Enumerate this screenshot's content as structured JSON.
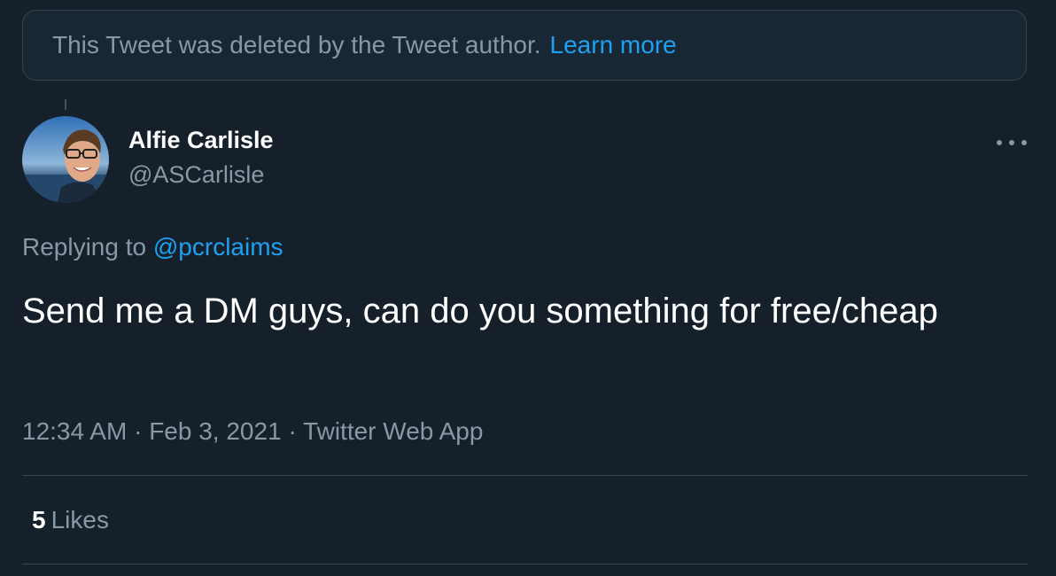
{
  "deleted_notice": {
    "text": "This Tweet was deleted by the Tweet author.",
    "learn_more": "Learn more"
  },
  "tweet": {
    "author_name": "Alfie Carlisle",
    "author_handle": "@ASCarlisle",
    "replying_label": "Replying to",
    "replying_to": "@pcrclaims",
    "text": "Send me a DM guys, can do you something for free/cheap",
    "time": "12:34 AM",
    "separator": "·",
    "date": "Feb 3, 2021",
    "source": "Twitter Web App",
    "likes_count": "5",
    "likes_label": "Likes"
  },
  "colors": {
    "background": "#15202b",
    "accent": "#1da1f2",
    "secondary_text": "#8899a6",
    "border": "#38444d"
  },
  "icons": {
    "more": "more-horizontal-icon"
  }
}
